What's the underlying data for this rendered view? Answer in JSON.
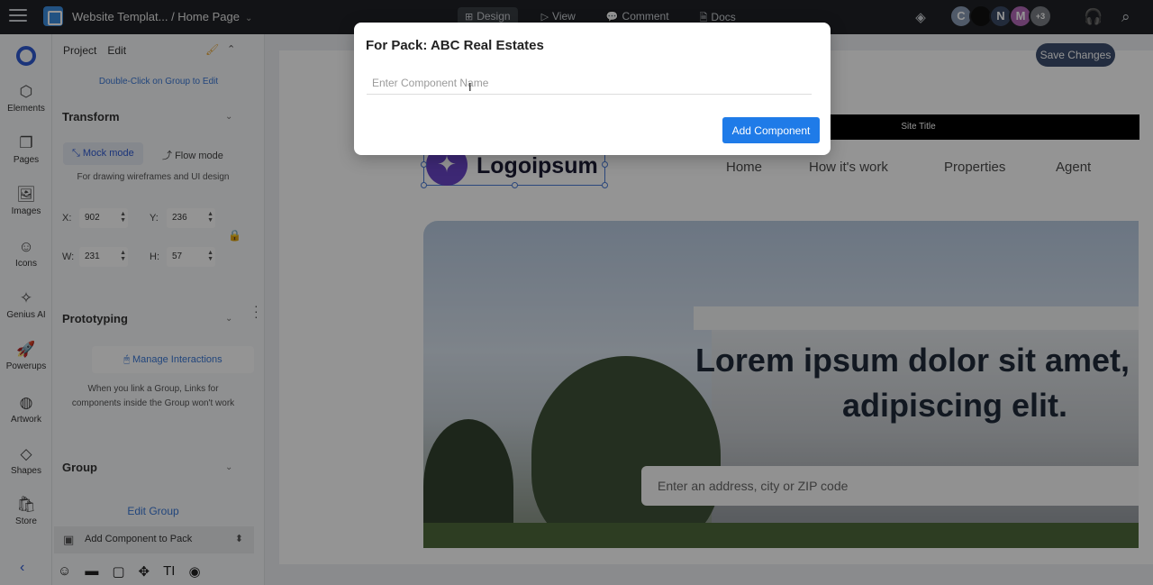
{
  "topbar": {
    "breadcrumb": "Website Templat... / Home Page",
    "breadcrumb_chev": "⌄",
    "tabs": [
      {
        "label": "Design",
        "icon": "⊞"
      },
      {
        "label": "View",
        "icon": "▷"
      },
      {
        "label": "Comment",
        "icon": "💬"
      },
      {
        "label": "Docs",
        "icon": "🗎"
      }
    ],
    "avatars": [
      {
        "letter": "C",
        "color": "#8a9bb5"
      },
      {
        "letter": "",
        "color": "#111111"
      },
      {
        "letter": "N",
        "color": "#3b4a66"
      },
      {
        "letter": "M",
        "color": "#b46ab8"
      },
      {
        "letter": "+3",
        "color": "#7a7f86"
      }
    ]
  },
  "rail": {
    "items": [
      {
        "label": "Elements",
        "icon": "⬡"
      },
      {
        "label": "Pages",
        "icon": "❐"
      },
      {
        "label": "Images",
        "icon": "🖼"
      },
      {
        "label": "Icons",
        "icon": "☺"
      },
      {
        "label": "Genius AI",
        "icon": "✧"
      },
      {
        "label": "Powerups",
        "icon": "🚀"
      },
      {
        "label": "Artwork",
        "icon": "◍"
      },
      {
        "label": "Shapes",
        "icon": "◇"
      },
      {
        "label": "Store",
        "icon": "🛍"
      }
    ]
  },
  "panel": {
    "tabs": [
      "Project",
      "Edit"
    ],
    "hint": "Double-Click on Group to Edit",
    "transform": {
      "title": "Transform",
      "mock_mode": "Mock mode",
      "flow_mode": "Flow mode",
      "description": "For drawing wireframes and UI design",
      "x_label": "X:",
      "x_value": "902",
      "y_label": "Y:",
      "y_value": "236",
      "w_label": "W:",
      "w_value": "231",
      "h_label": "H:",
      "h_value": "57"
    },
    "prototyping": {
      "title": "Prototyping",
      "manage": "Manage Interactions",
      "note": "When you link a Group, Links for components inside the Group won't work"
    },
    "group": {
      "title": "Group",
      "edit": "Edit Group"
    },
    "pack_bar": "Add Component to Pack"
  },
  "canvas": {
    "save_button": "Save Changes",
    "site_title": "Site Title",
    "logo_text": "Logoipsum",
    "nav": [
      "Home",
      "How it's work",
      "Properties",
      "Agent"
    ],
    "hero_title_line1": "Lorem ipsum dolor sit amet, cons",
    "hero_title_line2": "adipiscing elit.",
    "search_placeholder": "Enter an address, city or ZIP code"
  },
  "modal": {
    "title": "For Pack: ABC Real Estates",
    "input_placeholder": "Enter Component Name",
    "input_value": "",
    "submit": "Add Component"
  }
}
